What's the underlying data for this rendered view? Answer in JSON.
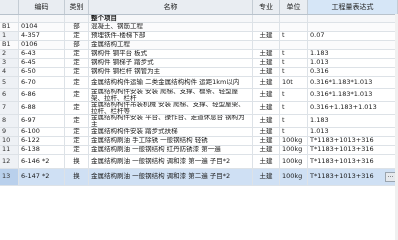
{
  "headers": {
    "num": "",
    "code": "编码",
    "type": "类别",
    "name": "名称",
    "spec": "专业",
    "unit": "单位",
    "expr": "工程量表达式"
  },
  "rows": [
    {
      "num": "",
      "code": "",
      "type": "",
      "name": "整个项目",
      "spec": "",
      "unit": "",
      "expr": "",
      "kind": "group"
    },
    {
      "num": "B1",
      "code": "0104",
      "type": "部",
      "name": "混凝土、钢筋工程",
      "spec": "",
      "unit": "",
      "expr": "",
      "kind": "section"
    },
    {
      "num": "1",
      "code": "4-357",
      "type": "定",
      "name": "预埋铁件-楼梯下部",
      "spec": "土建",
      "unit": "t",
      "expr": "0.07",
      "kind": "item"
    },
    {
      "num": "B1",
      "code": "0106",
      "type": "部",
      "name": "金属结构工程",
      "spec": "",
      "unit": "",
      "expr": "",
      "kind": "section"
    },
    {
      "num": "2",
      "code": "6-43",
      "type": "定",
      "name": "钢构件 钢平台 板式",
      "spec": "土建",
      "unit": "t",
      "expr": "1.183",
      "kind": "item"
    },
    {
      "num": "3",
      "code": "6-45",
      "type": "定",
      "name": "钢构件 钢梯子 踏步式",
      "spec": "土建",
      "unit": "t",
      "expr": "1.013",
      "kind": "item"
    },
    {
      "num": "4",
      "code": "6-50",
      "type": "定",
      "name": "钢构件 钢栏杆 钢管为主",
      "spec": "土建",
      "unit": "t",
      "expr": "0.316",
      "kind": "item"
    },
    {
      "num": "5",
      "code": "6-70",
      "type": "定",
      "name": "金属结构构件运输 二类金属结构构件 运距1km以内",
      "spec": "土建",
      "unit": "10t",
      "expr": "0.316*1.183*1.013",
      "kind": "item"
    },
    {
      "num": "6",
      "code": "6-86",
      "type": "定",
      "name": "金属结构构件安装 安装 爬梯、支撑、檩条、轻型屋架、拉杆、栏杆",
      "spec": "土建",
      "unit": "t",
      "expr": "0.316*1.183*1.013",
      "kind": "item"
    },
    {
      "num": "7",
      "code": "6-88",
      "type": "定",
      "name": "金属结构构件吊装机械 安装 爬梯、支撑、轻型屋架、拉杆、栏杆等",
      "spec": "土建",
      "unit": "t",
      "expr": "0.316+1.183+1.013",
      "kind": "item"
    },
    {
      "num": "8",
      "code": "6-97",
      "type": "定",
      "name": "金属结构构件安装 平台、操作台、走道休息台 钢构为主",
      "spec": "土建",
      "unit": "t",
      "expr": "1.183",
      "kind": "item"
    },
    {
      "num": "9",
      "code": "6-100",
      "type": "定",
      "name": "金属结构构件安装 踏步式扶梯",
      "spec": "土建",
      "unit": "t",
      "expr": "1.013",
      "kind": "item"
    },
    {
      "num": "10",
      "code": "6-122",
      "type": "定",
      "name": "金属结构刷油 手工除锈 一般钢结构 轻锈",
      "spec": "土建",
      "unit": "100kg",
      "expr": "T*1183+1013+316",
      "kind": "item"
    },
    {
      "num": "11",
      "code": "6-138",
      "type": "定",
      "name": "金属结构刷油 一般钢结构 红丹防锈漆 第一遍",
      "spec": "土建",
      "unit": "100kg",
      "expr": "T*1183+1013+316",
      "kind": "item"
    },
    {
      "num": "12",
      "code": "6-146 *2",
      "type": "换",
      "name": "金属结构刷油 一般钢结构 调和漆 第一遍 子目*2",
      "spec": "土建",
      "unit": "100kg",
      "expr": "T*1183+1013+316",
      "kind": "item"
    },
    {
      "num": "13",
      "code": "6-147 *2",
      "type": "换",
      "name": "金属结构刷油 一般钢结构 调和漆 第二遍 子目*2",
      "spec": "土建",
      "unit": "100kg",
      "expr": "T*1183+1013+316",
      "kind": "selected"
    }
  ],
  "ellipsis_label": "..."
}
